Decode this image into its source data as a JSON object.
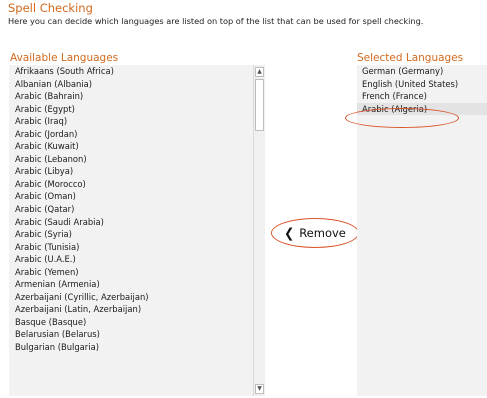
{
  "header": {
    "title": "Spell Checking",
    "subtitle": "Here you can decide which languages are listed on top of the list that can be used for spell checking."
  },
  "available": {
    "heading": "Available Languages",
    "items": [
      "Afrikaans (South Africa)",
      "Albanian (Albania)",
      "Arabic (Bahrain)",
      "Arabic (Egypt)",
      "Arabic (Iraq)",
      "Arabic (Jordan)",
      "Arabic (Kuwait)",
      "Arabic (Lebanon)",
      "Arabic (Libya)",
      "Arabic (Morocco)",
      "Arabic (Oman)",
      "Arabic (Qatar)",
      "Arabic (Saudi Arabia)",
      "Arabic (Syria)",
      "Arabic (Tunisia)",
      "Arabic (U.A.E.)",
      "Arabic (Yemen)",
      "Armenian (Armenia)",
      "Azerbaijani (Cyrillic, Azerbaijan)",
      "Azerbaijani (Latin, Azerbaijan)",
      "Basque (Basque)",
      "Belarusian (Belarus)",
      "Bulgarian (Bulgaria)"
    ],
    "scroll_up_icon": "triangle-up-icon",
    "scroll_down_icon": "triangle-down-icon"
  },
  "actions": {
    "remove_label": "Remove",
    "remove_icon": "chevron-left-icon"
  },
  "selected": {
    "heading": "Selected Languages",
    "items": [
      "German (Germany)",
      "English (United States)",
      "French (France)",
      "Arabic (Algeria)"
    ],
    "selected_index": 3
  },
  "colors": {
    "accent": "#d2691e",
    "highlight_circle": "#d9542b"
  }
}
